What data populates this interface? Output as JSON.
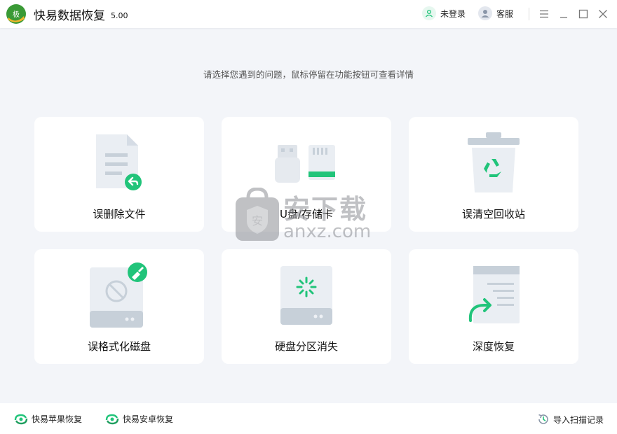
{
  "header": {
    "logo_text": "极",
    "app_name": "快易数据恢复",
    "version": "5.00",
    "login": "未登录",
    "service": "客服"
  },
  "main": {
    "prompt": "请选择您遇到的问题，鼠标停留在功能按钮可查看详情",
    "cards": [
      {
        "label": "误删除文件",
        "icon": "deleted-file-icon"
      },
      {
        "label": "U盘/存储卡",
        "icon": "usb-sd-card-icon"
      },
      {
        "label": "误清空回收站",
        "icon": "recycle-bin-icon"
      },
      {
        "label": "误格式化磁盘",
        "icon": "formatted-disk-icon"
      },
      {
        "label": "硬盘分区消失",
        "icon": "lost-partition-icon"
      },
      {
        "label": "深度恢复",
        "icon": "deep-recovery-icon"
      }
    ]
  },
  "footer": {
    "apple": "快易苹果恢复",
    "android": "快易安卓恢复",
    "import": "导入扫描记录"
  },
  "watermark": {
    "main": "安下载",
    "sub": "anxz.com"
  },
  "colors": {
    "accent": "#21c47a",
    "icon_gray": "#c7d0d9",
    "background": "#f3f5f9"
  }
}
